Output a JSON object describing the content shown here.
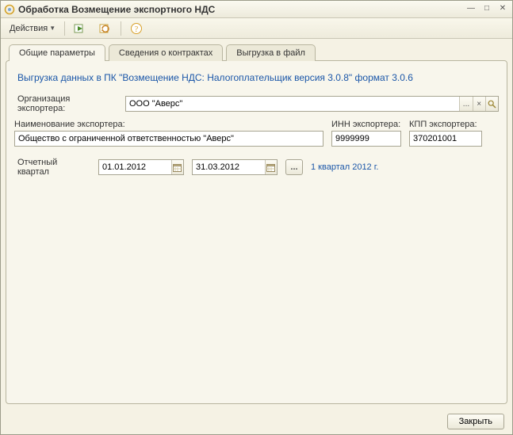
{
  "window": {
    "title": "Обработка  Возмещение экспортного НДС"
  },
  "toolbar": {
    "actions_label": "Действия"
  },
  "tabs": {
    "general": "Общие параметры",
    "contracts": "Сведения о контрактах",
    "export": "Выгрузка в файл"
  },
  "headline": "Выгрузка данных в ПК \"Возмещение НДС: Налогоплательщик версия 3.0.8\" формат 3.0.6",
  "labels": {
    "exporter_org": "Организация экспортера:",
    "exporter_name": "Наименование экспортера:",
    "inn": "ИНН экспортера:",
    "kpp": "КПП экспортера:",
    "report_quarter": "Отчетный квартал"
  },
  "values": {
    "exporter_org": "ООО \"Аверс\"",
    "exporter_name": "Общество с ограниченной ответственностью \"Аверс\"",
    "inn": "9999999",
    "kpp": "370201001",
    "date_from": "01.01.2012",
    "date_to": "31.03.2012",
    "period_text": "1 квартал 2012 г."
  },
  "footer": {
    "close": "Закрыть"
  },
  "icons": {
    "ellipsis": "...",
    "clear": "×",
    "search": "🔍",
    "calendar": "📅"
  }
}
